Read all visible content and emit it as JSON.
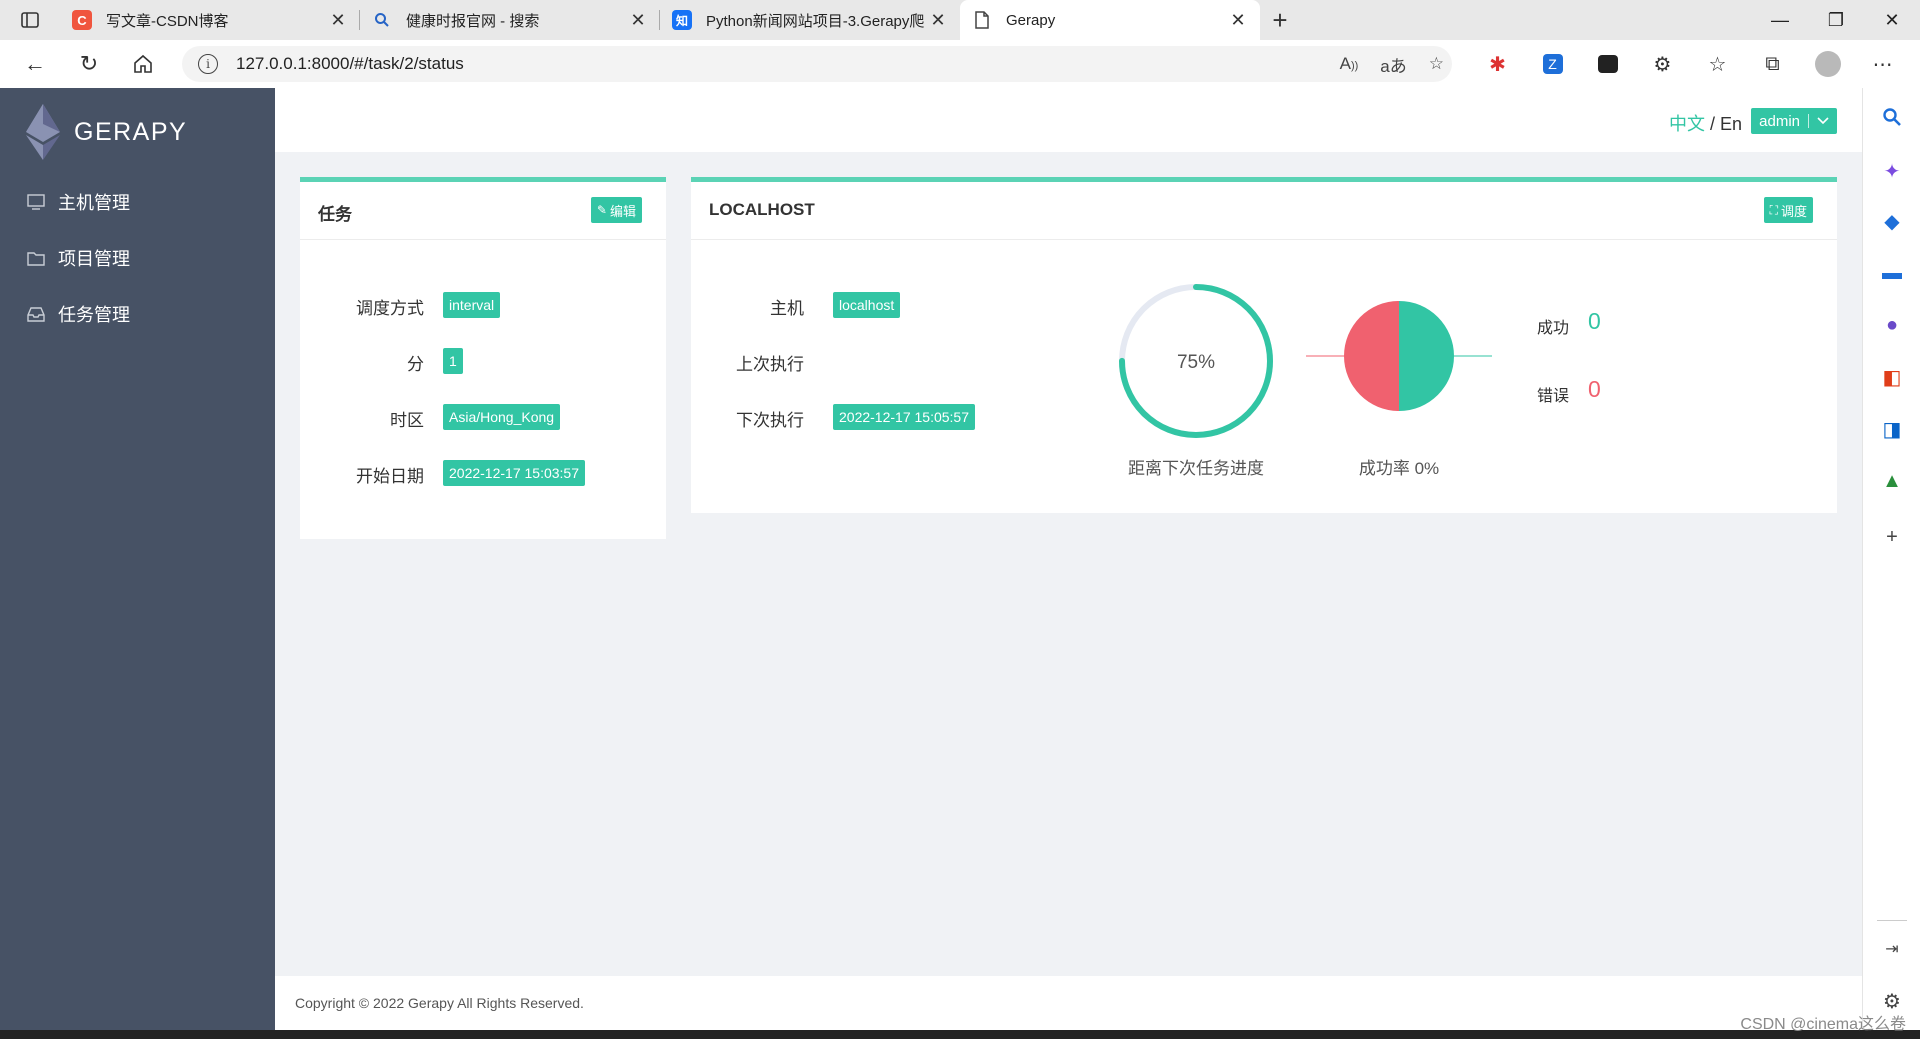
{
  "browser": {
    "tabs": [
      {
        "title": "写文章-CSDN博客",
        "icon": "csdn-icon",
        "color": "#f0553e",
        "glyph": "C"
      },
      {
        "title": "健康时报官网 - 搜索",
        "icon": "search-icon",
        "color": "#2664c6",
        "glyph": "Q"
      },
      {
        "title": "Python新闻网站项目-3.Gerapy爬",
        "icon": "zhihu-icon",
        "color": "#1772f6",
        "glyph": "知"
      },
      {
        "title": "Gerapy",
        "icon": "page-icon",
        "color": "#555555",
        "glyph": ""
      }
    ],
    "url": "127.0.0.1:8000/#/task/2/status"
  },
  "app": {
    "logo": "GERAPY",
    "menu": [
      {
        "label": "主机管理",
        "icon": "monitor-icon"
      },
      {
        "label": "项目管理",
        "icon": "folder-icon"
      },
      {
        "label": "任务管理",
        "icon": "inbox-icon"
      }
    ],
    "header": {
      "lang_zh": "中文",
      "lang_sep": " / ",
      "lang_en": "En",
      "user": "admin"
    },
    "task_card": {
      "title": "任务",
      "edit_label": "编辑",
      "fields": [
        {
          "label": "调度方式",
          "value": "interval"
        },
        {
          "label": "分",
          "value": "1"
        },
        {
          "label": "时区",
          "value": "Asia/Hong_Kong"
        },
        {
          "label": "开始日期",
          "value": "2022-12-17 15:03:57"
        }
      ]
    },
    "host_card": {
      "title": "LOCALHOST",
      "schedule_label": "调度",
      "fields": [
        {
          "label": "主机",
          "value": "localhost"
        },
        {
          "label": "上次执行",
          "value": ""
        },
        {
          "label": "下次执行",
          "value": "2022-12-17 15:05:57"
        }
      ],
      "progress": {
        "value": 0.75,
        "text": "75%",
        "caption": "距离下次任务进度"
      },
      "success_rate": {
        "caption": "成功率 0%",
        "success_fraction": 0.5
      },
      "stats": {
        "success_label": "成功",
        "success_value": "0",
        "error_label": "错误",
        "error_value": "0"
      }
    },
    "footer": "Copyright © 2022 Gerapy All Rights Reserved.",
    "colors": {
      "accent": "#32c5a4",
      "sidebar": "#475265",
      "error": "#f0616f",
      "success": "#32c5a4"
    }
  },
  "watermark": "CSDN @cinema这么卷"
}
